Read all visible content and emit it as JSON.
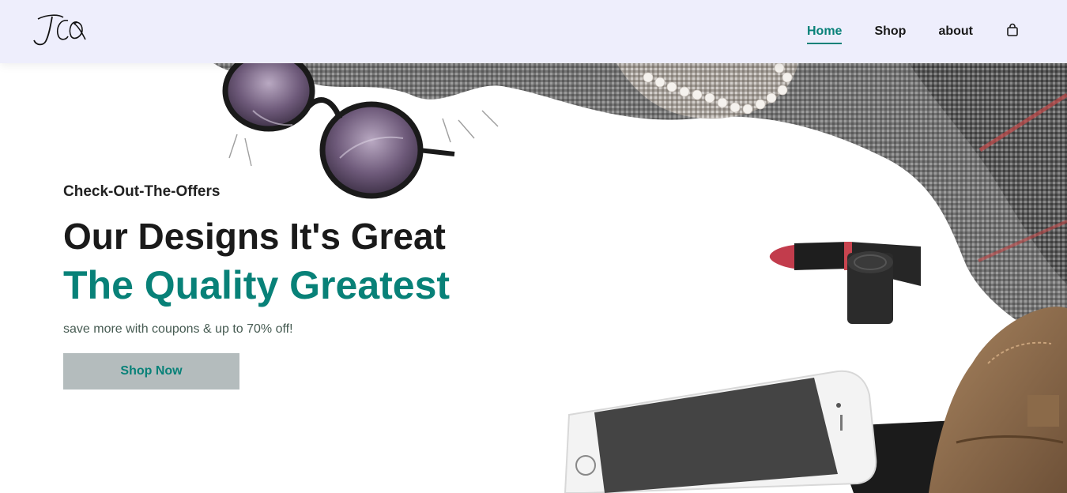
{
  "header": {
    "logo_text": "JCO",
    "nav": [
      {
        "label": "Home",
        "active": true
      },
      {
        "label": "Shop",
        "active": false
      },
      {
        "label": "about",
        "active": false
      }
    ],
    "cart_icon": "shopping-bag-icon"
  },
  "hero": {
    "eyebrow": "Check-Out-The-Offers",
    "heading": "Our Designs It's Great",
    "highlight": "The Quality Greatest",
    "subtext": "save more with coupons & up to 70% off!",
    "button_label": "Shop Now",
    "image_description_icons": [
      "sunglasses",
      "scarf",
      "lipstick",
      "smartphone",
      "leather-bag",
      "pearl-necklace"
    ]
  },
  "colors": {
    "accent": "#088178",
    "header_bg": "#eeeefc",
    "button_bg": "#b4bcbd",
    "text_dark": "#1a1a1a"
  }
}
